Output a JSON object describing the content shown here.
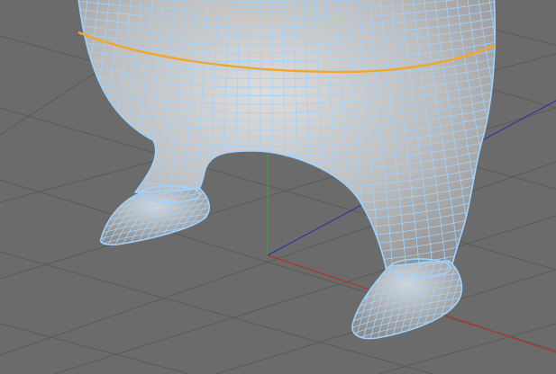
{
  "viewport": {
    "background": "#6b6b6b",
    "grid_color": "#595959"
  },
  "axes": {
    "x_color": "#c0282a",
    "y_color": "#2faa36",
    "z_color": "#2a2ea8"
  },
  "model": {
    "surface_light": "#d8d8d8",
    "surface_dark": "#8f8f8f",
    "wire_color": "#9fd2ff",
    "selected_loop_color": "#f2a62a"
  }
}
